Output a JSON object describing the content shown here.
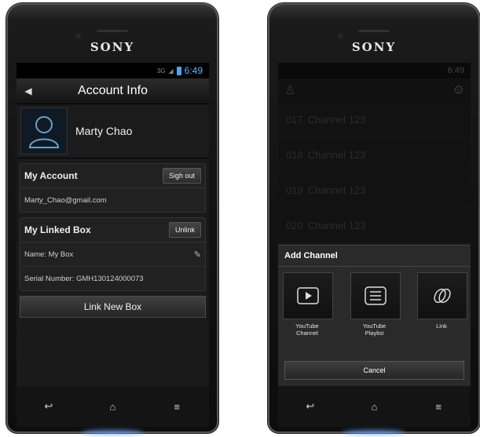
{
  "brand": "SONY",
  "left_phone": {
    "status": {
      "time": "6:49",
      "network": "3G"
    },
    "header": {
      "back_icon": "back-arrow-icon",
      "title": "Account Info"
    },
    "profile": {
      "name": "Marty Chao"
    },
    "my_account": {
      "title": "My Account",
      "sign_out_label": "Sigh out",
      "email": "Marty_Chao@gmail.com"
    },
    "linked_box": {
      "title": "My Linked Box",
      "unlink_label": "Unlink",
      "name": "Name: My Box",
      "serial": "Serial Number: GMH130124000073"
    },
    "link_new_box_label": "Link New Box"
  },
  "right_phone": {
    "status": {
      "time": "6:49"
    },
    "channels": [
      {
        "num": "017",
        "label": "Channel 123"
      },
      {
        "num": "018",
        "label": "Channel 123"
      },
      {
        "num": "019",
        "label": "Channel 123"
      },
      {
        "num": "020",
        "label": "Channel 123"
      }
    ],
    "dialog": {
      "title": "Add Channel",
      "options": [
        {
          "label": "YouTube\nChannel",
          "icon": "play-icon"
        },
        {
          "label": "YouTube\nPlaylist",
          "icon": "list-icon"
        },
        {
          "label": "Link",
          "icon": "link-icon"
        }
      ],
      "cancel_label": "Cancel"
    }
  },
  "colors": {
    "accent": "#4aa3ff",
    "background": "#1a1a1a"
  }
}
